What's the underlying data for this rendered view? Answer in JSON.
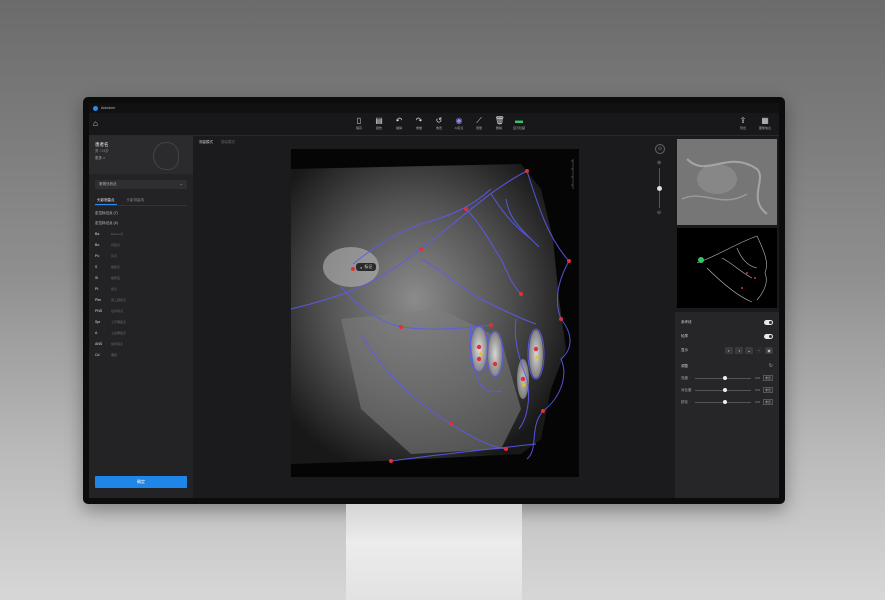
{
  "app": {
    "title": "Autodom"
  },
  "toolbar": {
    "tools": [
      {
        "label": "保存",
        "icon": "file-icon"
      },
      {
        "label": "报告",
        "icon": "report-icon"
      },
      {
        "label": "撤销",
        "icon": "undo-icon"
      },
      {
        "label": "重做",
        "icon": "redo-icon"
      },
      {
        "label": "重置",
        "icon": "reset-icon"
      },
      {
        "label": "AI定点",
        "icon": "ai-icon"
      },
      {
        "label": "测量",
        "icon": "measure-icon"
      },
      {
        "label": "删除",
        "icon": "delete-icon"
      },
      {
        "label": "显示隐藏",
        "icon": "display-icon"
      }
    ],
    "right_tools": [
      {
        "label": "导出",
        "icon": "export-icon"
      },
      {
        "label": "图像信息",
        "icon": "info-icon"
      }
    ]
  },
  "patient": {
    "name": "患者名",
    "info": "男 / 24岁",
    "more": "更多 >"
  },
  "left": {
    "select_value": "常规分析法",
    "tabs": [
      "头影测量点",
      "头影测量线"
    ],
    "sections": [
      "定位标记点 (7)",
      "定位标记点 (4)"
    ],
    "landmarks": [
      {
        "abbr": "Ba",
        "name": "Basion点"
      },
      {
        "abbr": "Bo",
        "name": "颅底点"
      },
      {
        "abbr": "Po",
        "name": "耳点"
      },
      {
        "abbr": "S",
        "name": "蝶鞍点"
      },
      {
        "abbr": "Si",
        "name": "蝶鞍底"
      },
      {
        "abbr": "Pt",
        "name": "翼点"
      },
      {
        "abbr": "Ptm",
        "name": "翼上颌裂点"
      },
      {
        "abbr": "PNS",
        "name": "后鼻棘点"
      },
      {
        "abbr": "Spr",
        "name": "上牙槽座点"
      },
      {
        "abbr": "A",
        "name": "上齿槽座点"
      },
      {
        "abbr": "ANS",
        "name": "前鼻棘点"
      },
      {
        "abbr": "Cd",
        "name": "髁突"
      }
    ],
    "confirm_label": "确定"
  },
  "center": {
    "tabs": [
      "测量模式",
      "描绘模式"
    ],
    "tooltip": "标记"
  },
  "right": {
    "toggles": [
      {
        "label": "参考线"
      },
      {
        "label": "轮廓"
      }
    ],
    "display_label": "显示",
    "adjust_label": "调整",
    "sliders": [
      {
        "label": "亮度",
        "value": "100",
        "level": 0.5
      },
      {
        "label": "对比度",
        "value": "100",
        "level": 0.5
      },
      {
        "label": "锐化",
        "value": "100",
        "level": 0.5
      }
    ],
    "reset_label": "重置"
  },
  "colors": {
    "accent": "#1f86e8",
    "trace": "#5b5bf0",
    "landmark": "#e0303a",
    "ai": "#8f8cf5"
  }
}
